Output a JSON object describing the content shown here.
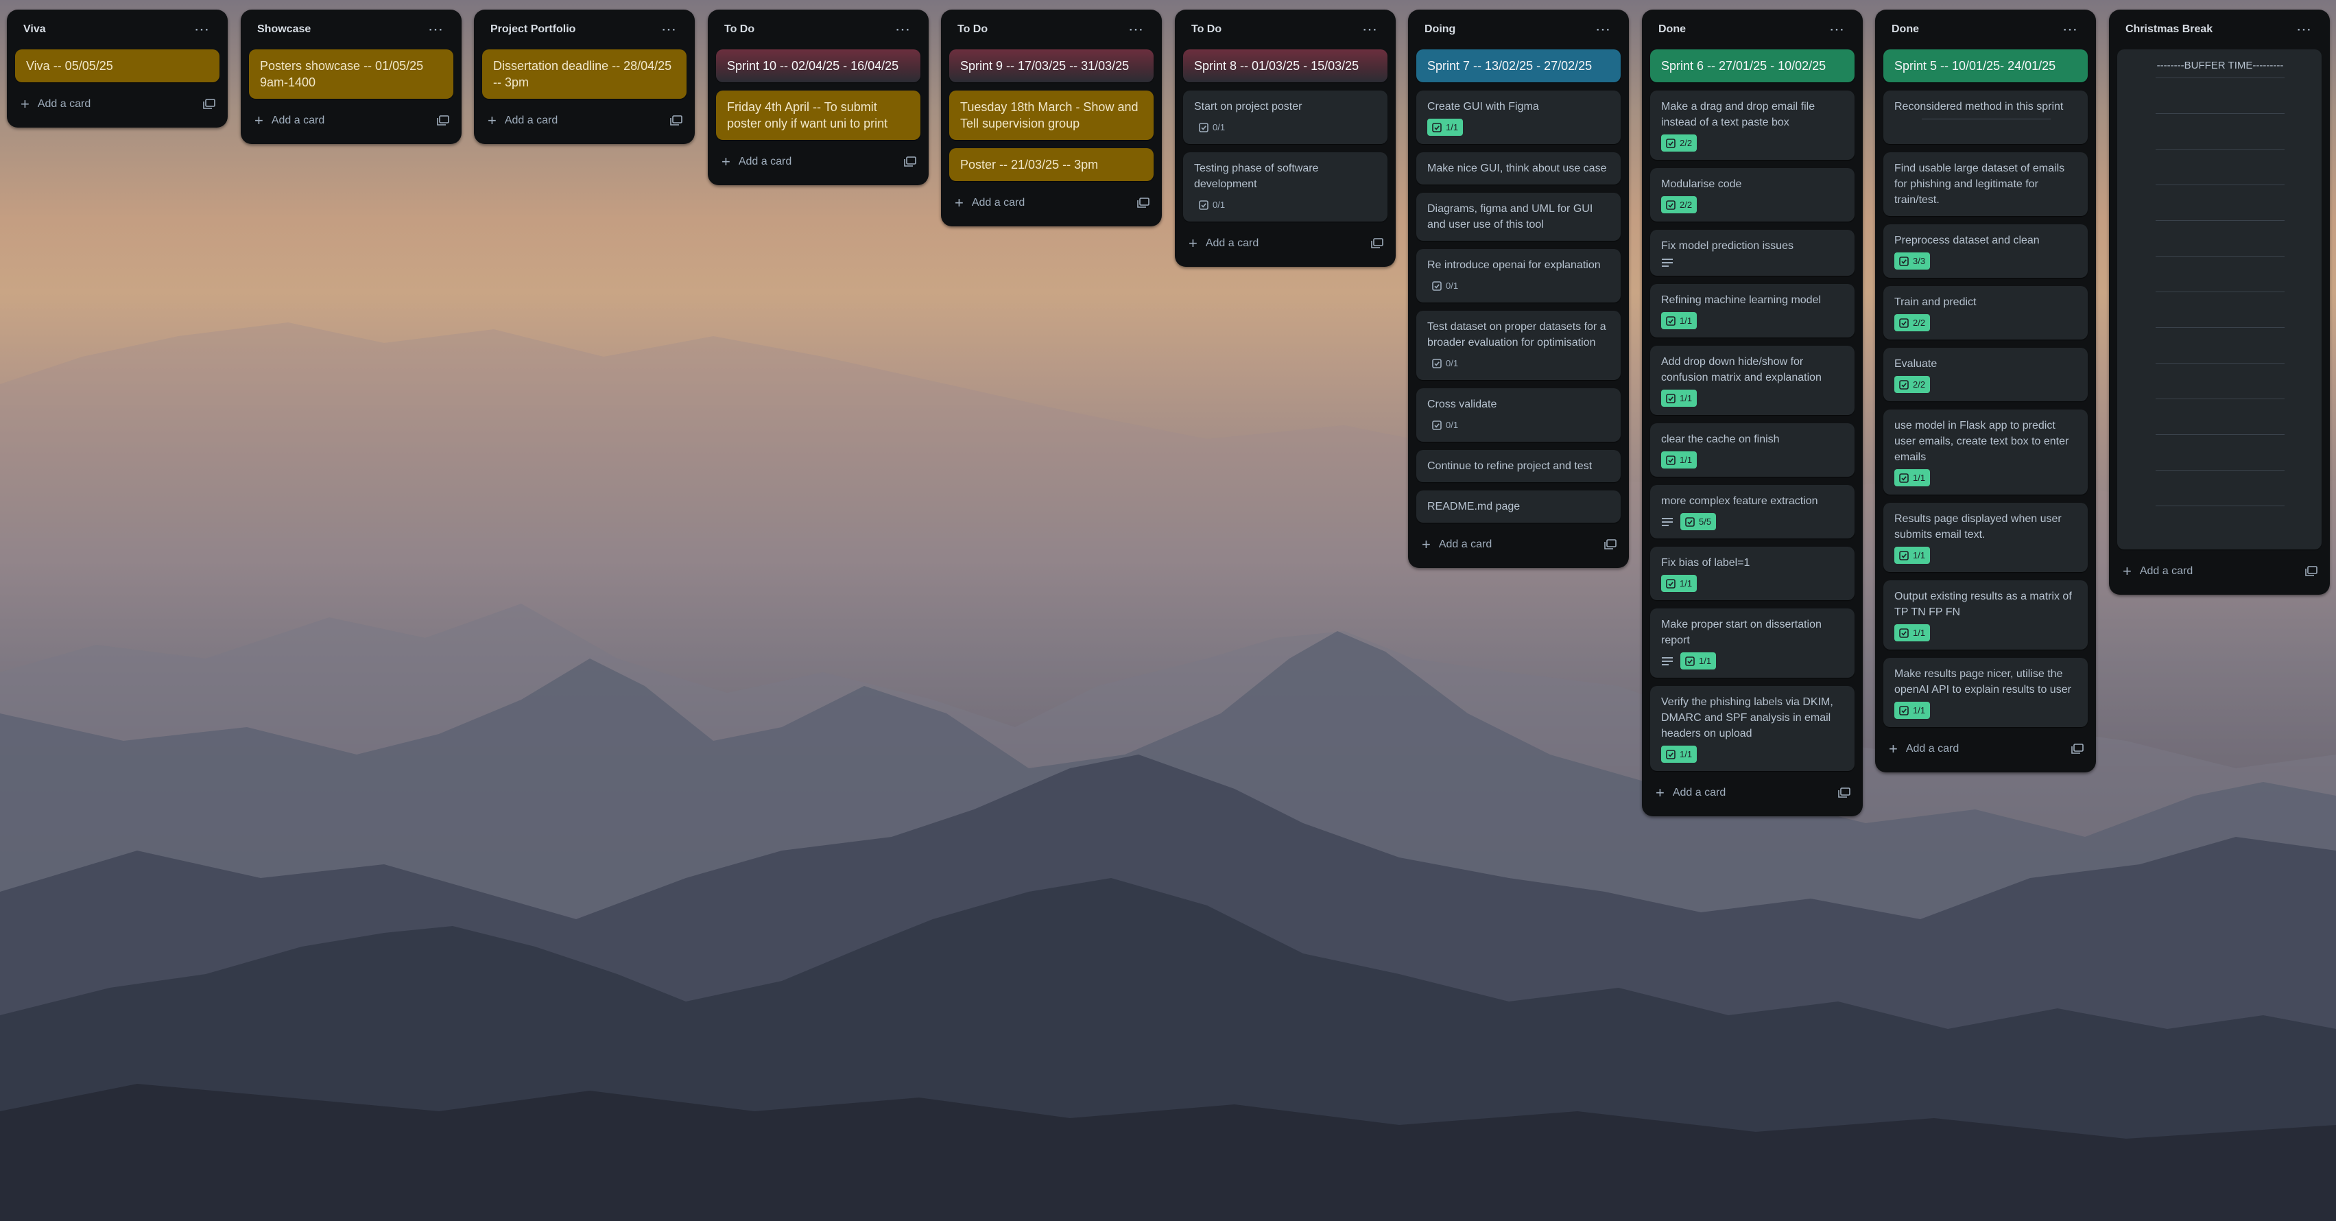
{
  "board": {
    "add_card_label": "Add a card",
    "colors": {
      "list_bg": "#0f1113",
      "card_bg": "#22272b",
      "yellow": "#7f5f01",
      "green_badge": "#4bce97",
      "sprint_blue": "#1f6a8a",
      "sprint_green": "#1f845a"
    },
    "lists": [
      {
        "title": "Viva",
        "cards": [
          {
            "text": "Viva -- 05/05/25",
            "style": "yellow"
          }
        ]
      },
      {
        "title": "Showcase",
        "cards": [
          {
            "text": "Posters showcase -- 01/05/25 9am-1400",
            "style": "yellow"
          }
        ]
      },
      {
        "title": "Project Portfolio",
        "cards": [
          {
            "text": "Dissertation deadline -- 28/04/25 -- 3pm",
            "style": "yellow"
          }
        ]
      },
      {
        "title": "To Do",
        "cards": [
          {
            "text": "Sprint 10 -- 02/04/25 - 16/04/25",
            "style": "sprint-maroon"
          },
          {
            "text": "Friday 4th April -- To submit poster only if want uni to print",
            "style": "yellow"
          }
        ]
      },
      {
        "title": "To Do",
        "cards": [
          {
            "text": "Sprint 9 -- 17/03/25 -- 31/03/25",
            "style": "sprint-maroon"
          },
          {
            "text": "Tuesday 18th March - Show and Tell supervision group",
            "style": "yellow"
          },
          {
            "text": "Poster -- 21/03/25 -- 3pm",
            "style": "yellow"
          }
        ]
      },
      {
        "title": "To Do",
        "cards": [
          {
            "text": "Sprint 8 -- 01/03/25 - 15/03/25",
            "style": "sprint-maroon"
          },
          {
            "text": "Start on project poster",
            "checklist": "0/1",
            "complete": false
          },
          {
            "text": "Testing phase of software development",
            "checklist": "0/1",
            "complete": false
          }
        ]
      },
      {
        "title": "Doing",
        "cards": [
          {
            "text": "Sprint 7 -- 13/02/25 - 27/02/25",
            "style": "sprint-blue"
          },
          {
            "text": "Create GUI with Figma",
            "checklist": "1/1",
            "complete": true
          },
          {
            "text": "Make nice GUI, think about use case"
          },
          {
            "text": "Diagrams, figma and UML for GUI and user use of this tool"
          },
          {
            "text": "Re introduce openai for explanation",
            "checklist": "0/1",
            "complete": false
          },
          {
            "text": "Test dataset on proper datasets for a broader evaluation for optimisation",
            "checklist": "0/1",
            "complete": false
          },
          {
            "text": "Cross validate",
            "checklist": "0/1",
            "complete": false
          },
          {
            "text": "Continue to refine project and test"
          },
          {
            "text": "README.md page"
          }
        ]
      },
      {
        "title": "Done",
        "cards": [
          {
            "text": "Sprint 6 -- 27/01/25 - 10/02/25",
            "style": "sprint-green"
          },
          {
            "text": "Make a drag and drop email file instead of a text paste box",
            "checklist": "2/2",
            "complete": true
          },
          {
            "text": "Modularise code",
            "checklist": "2/2",
            "complete": true
          },
          {
            "text": "Fix model prediction issues",
            "description": true
          },
          {
            "text": "Refining machine learning model",
            "checklist": "1/1",
            "complete": true
          },
          {
            "text": "Add drop down hide/show for confusion matrix and explanation",
            "checklist": "1/1",
            "complete": true
          },
          {
            "text": "clear the cache on finish",
            "checklist": "1/1",
            "complete": true
          },
          {
            "text": "more complex feature extraction",
            "description": true,
            "checklist": "5/5",
            "complete": true
          },
          {
            "text": "Fix bias of label=1",
            "checklist": "1/1",
            "complete": true
          },
          {
            "text": "Make proper start on dissertation report",
            "description": true,
            "checklist": "1/1",
            "complete": true
          },
          {
            "text": "Verify the phishing labels via DKIM, DMARC and SPF analysis in email headers on upload",
            "checklist": "1/1",
            "complete": true
          }
        ]
      },
      {
        "title": "Done",
        "cards": [
          {
            "text": "Sprint 5 -- 10/01/25- 24/01/25",
            "style": "sprint-green"
          },
          {
            "text": "Reconsidered method in this sprint",
            "separator": true
          },
          {
            "text": "Find usable large dataset of emails for phishing and legitimate for train/test."
          },
          {
            "text": "Preprocess dataset and clean",
            "checklist": "3/3",
            "complete": true
          },
          {
            "text": "Train and predict",
            "checklist": "2/2",
            "complete": true
          },
          {
            "text": "Evaluate",
            "checklist": "2/2",
            "complete": true
          },
          {
            "text": "use model in Flask app to predict user emails, create text box to enter emails",
            "checklist": "1/1",
            "complete": true
          },
          {
            "text": "Results page displayed when user submits email text.",
            "checklist": "1/1",
            "complete": true
          },
          {
            "text": "Output existing results as a matrix of TP TN FP FN",
            "checklist": "1/1",
            "complete": true
          },
          {
            "text": "Make results page nicer, utilise the openAI API to explain results to user",
            "checklist": "1/1",
            "complete": true
          }
        ]
      },
      {
        "title": "Christmas Break",
        "cards": [
          {
            "text": "--------BUFFER TIME---------",
            "style": "buffer",
            "lines": 13
          }
        ]
      }
    ]
  }
}
